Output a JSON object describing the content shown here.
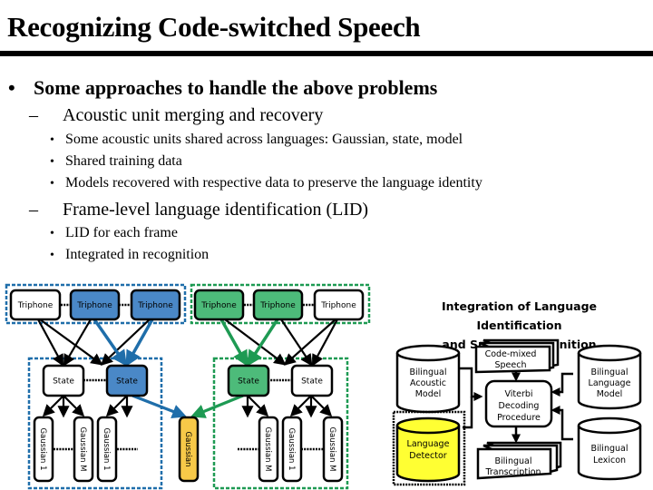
{
  "slide": {
    "title": "Recognizing Code-switched Speech",
    "bullets": [
      {
        "level": 1,
        "marker": "•",
        "text": "Some approaches to handle the above problems"
      },
      {
        "level": 2,
        "marker": "–",
        "text": "Acoustic unit merging and recovery"
      },
      {
        "level": 3,
        "marker": "•",
        "text": "Some acoustic units shared across languages: Gaussian, state, model"
      },
      {
        "level": 3,
        "marker": "•",
        "text": "Shared training data"
      },
      {
        "level": 3,
        "marker": "•",
        "text": "Models recovered with respective data to preserve the language identity"
      },
      {
        "level": 2,
        "marker": "–",
        "text": "Frame-level language identification (LID)"
      },
      {
        "level": 3,
        "marker": "•",
        "text": "LID for each frame"
      },
      {
        "level": 3,
        "marker": "•",
        "text": "Integrated in recognition"
      }
    ]
  },
  "left_diagram": {
    "colors": {
      "blue": "#4a88c7",
      "blue_dark": "#1f6eaa",
      "green": "#4dbb7a",
      "green_dark": "#1e9a53",
      "shared": "#f7c948"
    },
    "blue_group": {
      "triphones": [
        {
          "label": "Triphone",
          "highlight": false
        },
        {
          "label": "Triphone",
          "highlight": true
        },
        {
          "label": "Triphone",
          "highlight": true
        }
      ],
      "states": [
        {
          "label": "State",
          "highlight": false
        },
        {
          "label": "State",
          "highlight": true
        }
      ],
      "gaussians": [
        "Gaussian 1",
        "Gaussian M",
        "Gaussian 1"
      ]
    },
    "shared_gaussian": "Gaussian",
    "green_group": {
      "triphones": [
        {
          "label": "Triphone",
          "highlight": true
        },
        {
          "label": "Triphone",
          "highlight": true
        },
        {
          "label": "Triphone",
          "highlight": false
        }
      ],
      "states": [
        {
          "label": "State",
          "highlight": true
        },
        {
          "label": "State",
          "highlight": false
        }
      ],
      "gaussians": [
        "Gaussian M",
        "Gaussian 1",
        "Gaussian M"
      ]
    }
  },
  "right_diagram": {
    "title_line1": "Integration of Language Identification",
    "title_line2": "and Speech Recognition",
    "code_mixed_speech": [
      "Code-mixed",
      "Speech"
    ],
    "acoustic_model": [
      "Bilingual",
      "Acoustic",
      "Model"
    ],
    "language_model": [
      "Bilingual",
      "Language",
      "Model"
    ],
    "viterbi": [
      "Viterbi",
      "Decoding",
      "Procedure"
    ],
    "language_detector": [
      "Language",
      "Detector"
    ],
    "transcription": [
      "Bilingual",
      "Transcription"
    ],
    "lexicon": [
      "Bilingual",
      "Lexicon"
    ],
    "detector_color": "#ffff33"
  }
}
